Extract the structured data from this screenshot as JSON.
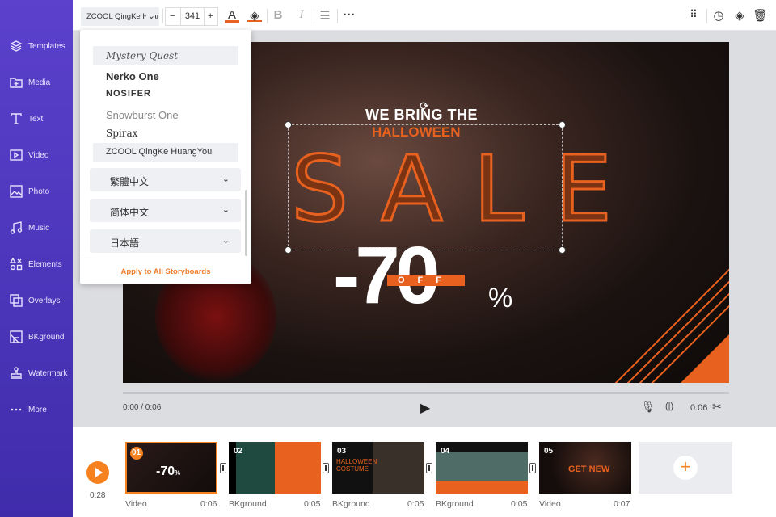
{
  "sidebar": {
    "items": [
      {
        "label": "Templates",
        "icon": "layers-icon"
      },
      {
        "label": "Media",
        "icon": "folder-plus-icon"
      },
      {
        "label": "Text",
        "icon": "text-icon"
      },
      {
        "label": "Video",
        "icon": "video-icon"
      },
      {
        "label": "Photo",
        "icon": "photo-icon"
      },
      {
        "label": "Music",
        "icon": "music-icon"
      },
      {
        "label": "Elements",
        "icon": "elements-icon"
      },
      {
        "label": "Overlays",
        "icon": "overlays-icon"
      },
      {
        "label": "BKground",
        "icon": "background-icon"
      },
      {
        "label": "Watermark",
        "icon": "watermark-icon"
      },
      {
        "label": "More",
        "icon": "more-icon"
      }
    ]
  },
  "toolbar": {
    "font": "ZCOOL QingKe HuangYou",
    "font_size": "341",
    "minus": "−",
    "plus": "+"
  },
  "font_dropdown": {
    "fonts": [
      "Mystery Quest",
      "Nerko One",
      "NOSIFER",
      "Snowburst One",
      "Spirax",
      "ZCOOL QingKe HuangYou"
    ],
    "languages": [
      "繁體中文",
      "简体中文",
      "日本語"
    ],
    "apply_label": "Apply to All Storyboards"
  },
  "canvas": {
    "line1": "WE BRING THE",
    "line2": "HALLOWEEN",
    "sale": "SALE",
    "discount": "-70",
    "percent": "%",
    "off": "OFF"
  },
  "player": {
    "time": "0:00 / 0:06",
    "duration": "0:06"
  },
  "storyboard": {
    "total": "0:28",
    "clips": [
      {
        "num": "01",
        "type": "Video",
        "duration": "0:06"
      },
      {
        "num": "02",
        "type": "BKground",
        "duration": "0:05"
      },
      {
        "num": "03",
        "type": "BKground",
        "duration": "0:05"
      },
      {
        "num": "04",
        "type": "BKground",
        "duration": "0:05"
      },
      {
        "num": "05",
        "type": "Video",
        "duration": "0:07"
      }
    ]
  },
  "colors": {
    "accent": "#f5811f",
    "sidebar": "#4b33bb",
    "sale": "#e8611f"
  }
}
